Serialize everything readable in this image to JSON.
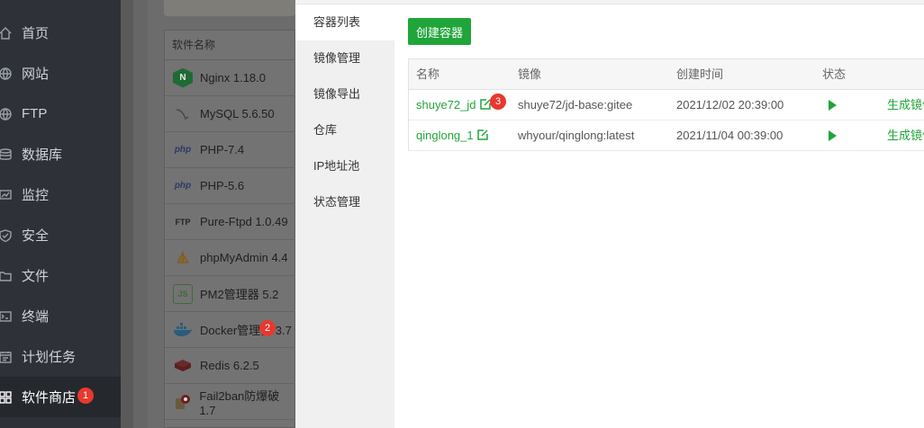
{
  "sidebar": {
    "items": [
      {
        "label": "首页",
        "icon": "home-icon"
      },
      {
        "label": "网站",
        "icon": "globe-icon"
      },
      {
        "label": "FTP",
        "icon": "globe-icon"
      },
      {
        "label": "数据库",
        "icon": "database-icon"
      },
      {
        "label": "监控",
        "icon": "monitor-icon"
      },
      {
        "label": "安全",
        "icon": "shield-icon"
      },
      {
        "label": "文件",
        "icon": "folder-icon"
      },
      {
        "label": "终端",
        "icon": "terminal-icon"
      },
      {
        "label": "计划任务",
        "icon": "calendar-icon"
      },
      {
        "label": "软件商店",
        "icon": "grid-icon",
        "active": true,
        "badge": "1"
      }
    ]
  },
  "software_list": {
    "header": "软件名称",
    "rows": [
      {
        "name": "Nginx 1.18.0",
        "icon": "nginx-icon",
        "icon_text": "N"
      },
      {
        "name": "MySQL 5.6.50",
        "icon": "mysql-icon",
        "icon_text": ""
      },
      {
        "name": "PHP-7.4",
        "icon": "php-icon",
        "icon_text": "php"
      },
      {
        "name": "PHP-5.6",
        "icon": "php-icon",
        "icon_text": "php"
      },
      {
        "name": "Pure-Ftpd 1.0.49",
        "icon": "ftp-icon",
        "icon_text": "FTP"
      },
      {
        "name": "phpMyAdmin 4.4",
        "icon": "phpmyadmin-icon",
        "icon_text": ""
      },
      {
        "name": "PM2管理器 5.2",
        "icon": "nodejs-icon",
        "icon_text": "JS"
      },
      {
        "name": "Docker管理器 3.7",
        "icon": "docker-icon",
        "icon_text": "",
        "badge": "2"
      },
      {
        "name": "Redis 6.2.5",
        "icon": "redis-icon",
        "icon_text": ""
      },
      {
        "name": "Fail2ban防爆破 1.7",
        "icon": "fail2ban-icon",
        "icon_text": ""
      }
    ]
  },
  "modal": {
    "nav": [
      "容器列表",
      "镜像管理",
      "镜像导出",
      "仓库",
      "IP地址池",
      "状态管理"
    ],
    "active_nav": 0,
    "create_button": "创建容器",
    "table": {
      "columns": [
        "名称",
        "镜像",
        "创建时间",
        "状态"
      ],
      "rows": [
        {
          "name": "shuye72_jd",
          "image": "shuye72/jd-base:gitee",
          "created": "2021/12/02 20:39:00",
          "status": "running",
          "action": "生成镜像",
          "badge": "3"
        },
        {
          "name": "qinglong_1",
          "image": "whyour/qinglong:latest",
          "created": "2021/11/04 00:39:00",
          "status": "running",
          "action": "生成镜像"
        }
      ]
    }
  },
  "colors": {
    "accent": "#20a53a",
    "badge": "#e8382f",
    "sidebar_bg": "#2e3238"
  }
}
